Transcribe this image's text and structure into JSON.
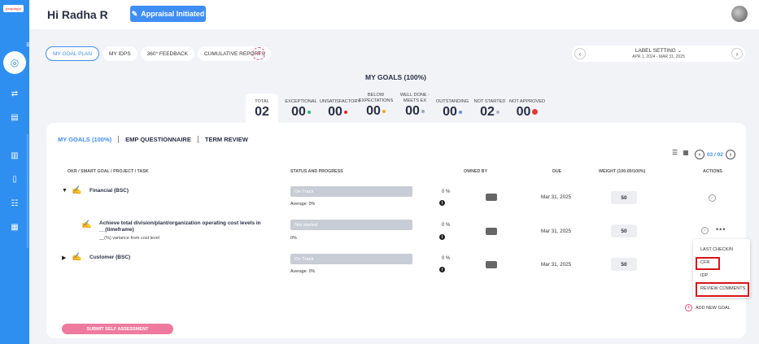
{
  "header": {
    "greeting": "Hi Radha R",
    "status_badge": "Appraisal Initiated"
  },
  "logo_text": "peoplogic",
  "tabs": [
    "MY GOAL PLAN",
    "MY IDPS",
    "360° FEEDBACK",
    "CUMULATIVE REPORTS"
  ],
  "label_setting": {
    "title": "LABEL SETTING",
    "date_range": "APR 1, 2024 - MAR 31, 2025"
  },
  "summary": {
    "title": "MY GOALS (100%)",
    "stats": [
      {
        "label": "TOTAL",
        "value": "02"
      },
      {
        "label": "EXCEPTIONAL",
        "value": "00",
        "color": "#2bb673"
      },
      {
        "label": "UNSATISFACTORY",
        "value": "00",
        "color": "#e02a2a"
      },
      {
        "label": "BELOW EXPECTATIONS",
        "value": "00",
        "color": "#f5a623"
      },
      {
        "label": "WELL DONE - MEETS EX",
        "value": "00",
        "color": "#9aa3b5"
      },
      {
        "label": "OUTSTANDING",
        "value": "00",
        "color": "#5b8ef5"
      },
      {
        "label": "NOT STARTED",
        "value": "02",
        "color": "#b0b5c2"
      },
      {
        "label": "NOT APPROVED",
        "value": "00",
        "color": "#e23a3a"
      }
    ]
  },
  "subtabs": [
    "MY GOALS (100%)",
    "EMP QUESTIONNAIRE",
    "TERM REVIEW"
  ],
  "pager": "03 / 02",
  "columns": {
    "okr": "OKR / SMART GOAL / PROJECT / TASK",
    "status": "STATUS AND PROGRESS",
    "owned": "OWNED BY",
    "due": "DUE",
    "weight": "WEIGHT (100.00/100%)",
    "actions": "ACTIONS"
  },
  "rows": [
    {
      "title": "Financial (BSC)",
      "status": "On Track",
      "avg": "Average: 0%",
      "pct": "0 %",
      "due": "Mar 31, 2025",
      "weight": "50"
    },
    {
      "title": "Achieve total division/plant/organization operating cost levels in __(timeframe)",
      "sub": "__(%) variance from cost level",
      "status": "Not started",
      "avg": "0%",
      "pct": "0 %",
      "due": "Mar 31, 2025",
      "weight": "50"
    },
    {
      "title": "Customer (BSC)",
      "status": "On Track",
      "avg": "Average: 0%",
      "pct": "0 %",
      "due": "Mar 31, 2025",
      "weight": "50"
    }
  ],
  "dropdown": [
    "LAST CHECKIN",
    "CFR",
    "IDP",
    "REVIEW COMMENTS"
  ],
  "add_goal": "ADD NEW GOAL",
  "submit": "SUBMIT SELF ASSESSMENT"
}
